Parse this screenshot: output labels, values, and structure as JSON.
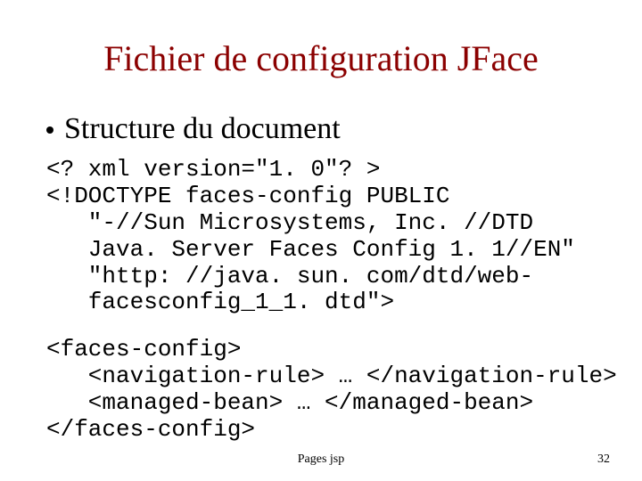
{
  "title": "Fichier de configuration JFace",
  "bullet": "Structure du document",
  "code1": "<? xml version=\"1. 0\"? >\n<!DOCTYPE faces-config PUBLIC\n   \"-//Sun Microsystems, Inc. //DTD\n   Java. Server Faces Config 1. 1//EN\"\n   \"http: //java. sun. com/dtd/web-\n   facesconfig_1_1. dtd\">",
  "code2": "<faces-config>\n   <navigation-rule> … </navigation-rule>\n   <managed-bean> … </managed-bean>\n</faces-config>",
  "footer_center": "Pages jsp",
  "footer_right": "32"
}
